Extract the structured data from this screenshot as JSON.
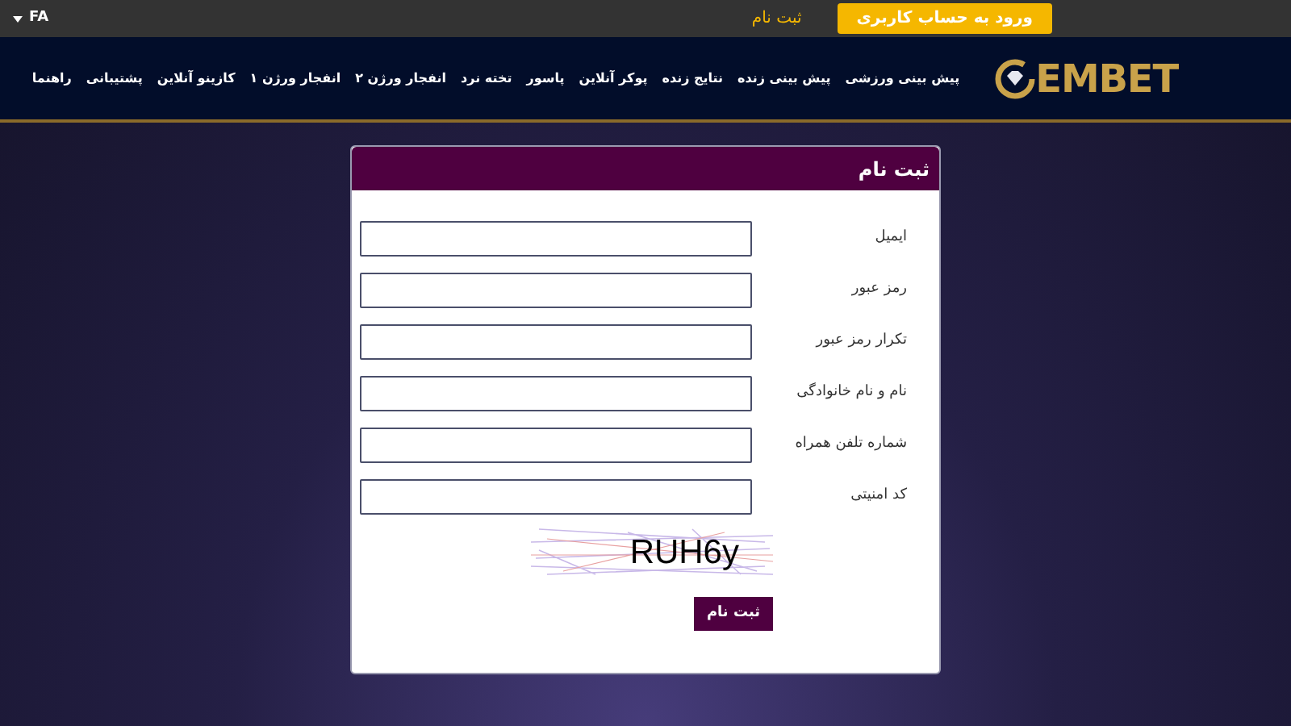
{
  "top_bar": {
    "language": "FA",
    "register_link": "ثبت نام",
    "login_button": "ورود به حساب کاربری"
  },
  "logo": {
    "text": "EMBET"
  },
  "nav": {
    "items": [
      "پیش بینی ورزشی",
      "پیش بینی زنده",
      "نتایج زنده",
      "پوکر آنلاین",
      "پاسور",
      "تخته نرد",
      "انفجار ورژن ۲",
      "انفجار ورژن ۱",
      "کازینو آنلاین",
      "پشتیبانی",
      "راهنما"
    ]
  },
  "form": {
    "title": "ثبت نام",
    "fields": [
      {
        "label": "ایمیل"
      },
      {
        "label": "رمز عبور"
      },
      {
        "label": "تکرار رمز عبور"
      },
      {
        "label": "نام و نام خانوادگی"
      },
      {
        "label": "شماره تلفن همراه"
      },
      {
        "label": "کد امنیتی"
      }
    ],
    "captcha": "RUH6y",
    "submit": "ثبت نام"
  }
}
